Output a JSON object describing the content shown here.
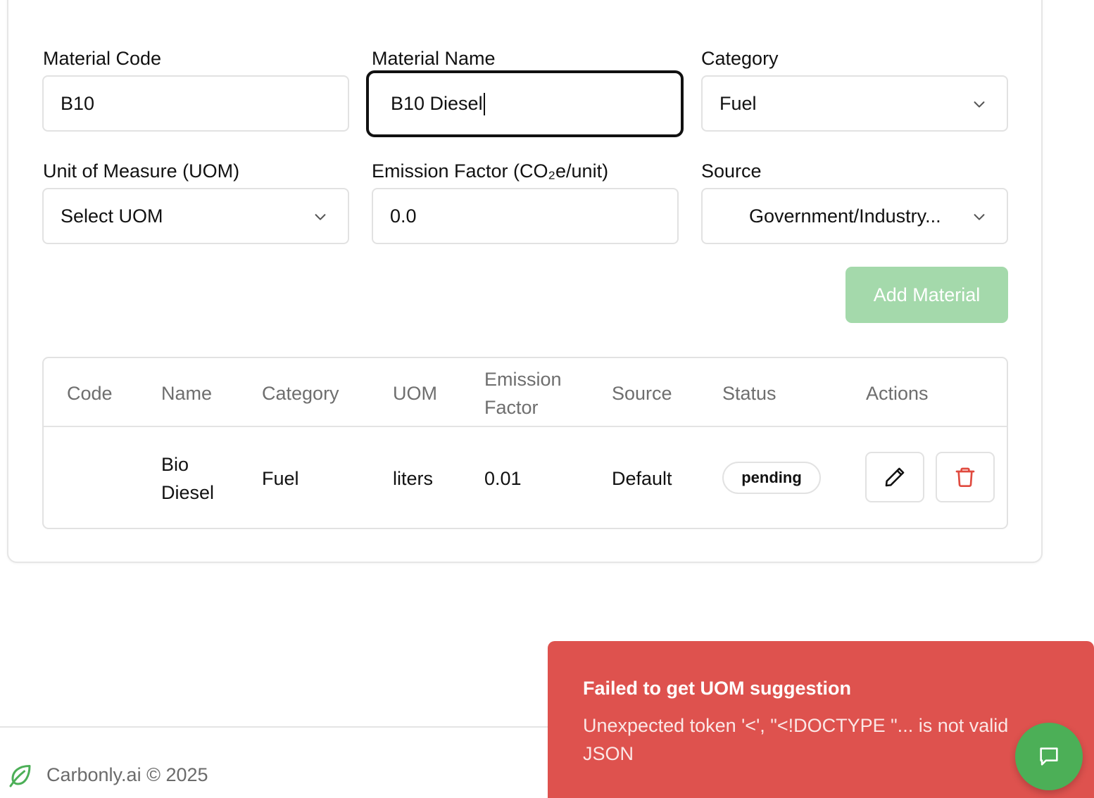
{
  "form": {
    "material_code": {
      "label": "Material Code",
      "value": "B10"
    },
    "material_name": {
      "label": "Material Name",
      "value": "B10 Diesel"
    },
    "category": {
      "label": "Category",
      "value": "Fuel"
    },
    "uom": {
      "label": "Unit of Measure (UOM)",
      "value": "Select UOM"
    },
    "emission_factor": {
      "label": "Emission Factor (CO₂e/unit)",
      "value": "0.0"
    },
    "source": {
      "label": "Source",
      "value": "Government/Industry..."
    },
    "add_button_label": "Add Material"
  },
  "table": {
    "headers": {
      "code": "Code",
      "name": "Name",
      "category": "Category",
      "uom": "UOM",
      "emission_factor_1": "Emission",
      "emission_factor_2": "Factor",
      "source": "Source",
      "status": "Status",
      "actions": "Actions"
    },
    "rows": [
      {
        "code": "",
        "name_1": "Bio",
        "name_2": "Diesel",
        "category": "Fuel",
        "uom": "liters",
        "emission_factor": "0.01",
        "source": "Default",
        "status": "pending"
      }
    ]
  },
  "footer": {
    "text": "Carbonly.ai © 2025"
  },
  "toast": {
    "title": "Failed to get UOM suggestion",
    "message": "Unexpected token '<', \"<!DOCTYPE \"... is not valid JSON"
  },
  "colors": {
    "accent_green": "#4caf57",
    "disabled_green": "#a4d9ab",
    "error_red": "#de524e",
    "delete_red": "#e04a3f"
  }
}
